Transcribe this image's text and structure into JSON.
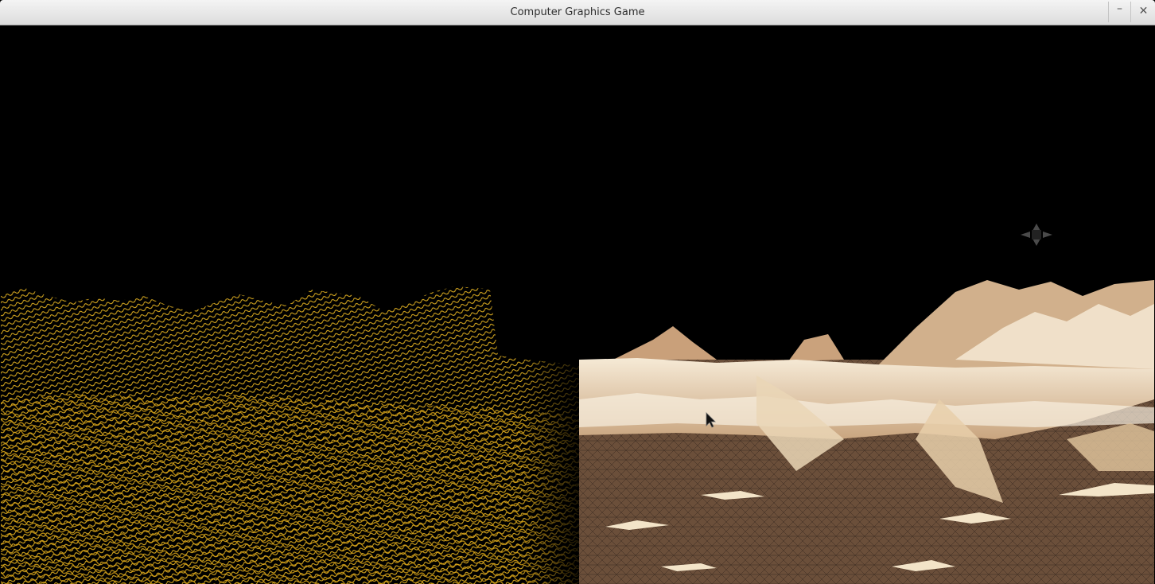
{
  "window": {
    "title": "Computer Graphics Game",
    "minimize_glyph": "–",
    "close_glyph": "✕"
  },
  "scene": {
    "left_half_mode": "wireframe",
    "right_half_mode": "shaded",
    "wire_color": "#e6b422",
    "sand_color": "#e9d2b0",
    "ground_color": "#6b4f3a",
    "sky_color": "#000000"
  },
  "icons": {
    "crosshair": "move-crosshair-icon",
    "cursor": "mouse-pointer-icon"
  }
}
